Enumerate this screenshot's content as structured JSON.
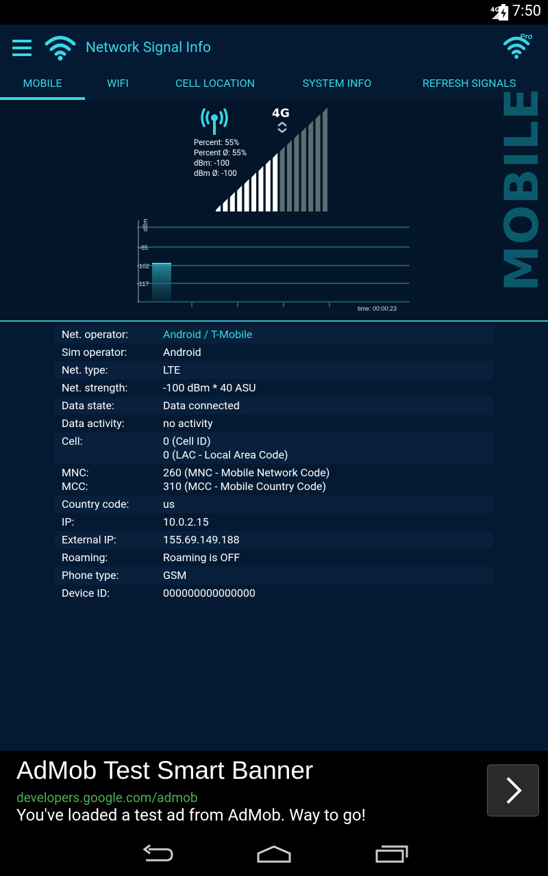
{
  "status_bar": {
    "network": "4G",
    "time": "7:50"
  },
  "app_bar": {
    "title": "Network Signal Info",
    "pro_badge": "Pro"
  },
  "tabs": [
    {
      "label": "MOBILE",
      "active": true
    },
    {
      "label": "WIFI",
      "active": false
    },
    {
      "label": "CELL LOCATION",
      "active": false
    },
    {
      "label": "SYSTEM INFO",
      "active": false
    },
    {
      "label": "REFRESH SIGNALS",
      "active": false
    }
  ],
  "signal": {
    "side_label": "MOBILE",
    "network_type": "4G",
    "stats": [
      "Percent: 55%",
      "Percent Ø: 55%",
      "dBm: -100",
      "dBm Ø: -100"
    ],
    "percent": 55,
    "bar_count": 16,
    "filled_bars": 9
  },
  "graph": {
    "y_label": "dBm",
    "y_ticks": [
      "-85",
      "-102",
      "-117"
    ],
    "time_label": "time: 00:00:23",
    "current_dbm": -100
  },
  "details": [
    {
      "label": "Net. operator:",
      "value": "Android / T-Mobile",
      "link": true
    },
    {
      "label": "Sim operator:",
      "value": "Android"
    },
    {
      "label": "Net. type:",
      "value": "LTE"
    },
    {
      "label": "Net. strength:",
      "value": "-100 dBm * 40 ASU"
    },
    {
      "label": "Data state:",
      "value": "Data connected"
    },
    {
      "label": "Data activity:",
      "value": "no activity"
    },
    {
      "label": "Cell:",
      "value": "0 (Cell ID)",
      "value2": "0 (LAC - Local Area Code)"
    },
    {
      "label": "MNC:",
      "label2": "MCC:",
      "value": "260 (MNC - Mobile Network Code)",
      "value2": "310 (MCC - Mobile Country Code)"
    },
    {
      "label": "Country code:",
      "value": "us"
    },
    {
      "label": "IP:",
      "value": "10.0.2.15"
    },
    {
      "label": "External IP:",
      "value": "155.69.149.188"
    },
    {
      "label": "Roaming:",
      "value": "Roaming is OFF"
    },
    {
      "label": "Phone type:",
      "value": "GSM"
    },
    {
      "label": "Device ID:",
      "value": "000000000000000"
    }
  ],
  "ad": {
    "title": "AdMob Test Smart Banner",
    "url": "developers.google.com/admob",
    "description": "You've loaded a test ad from AdMob. Way to go!"
  },
  "colors": {
    "accent": "#36d8e6",
    "background": "#041a33",
    "panel": "#031529"
  }
}
